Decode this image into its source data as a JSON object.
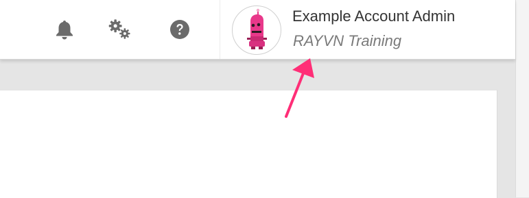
{
  "header": {
    "icons": {
      "notifications": "bell-icon",
      "settings": "gears-icon",
      "help": "help-icon"
    },
    "account": {
      "name": "Example Account Admin",
      "organization": "RAYVN Training",
      "avatar": "robot-avatar"
    }
  },
  "annotation": {
    "arrow_color": "#ff2e77"
  },
  "colors": {
    "icon": "#6b6b6b",
    "avatar_accent": "#e8388a"
  }
}
